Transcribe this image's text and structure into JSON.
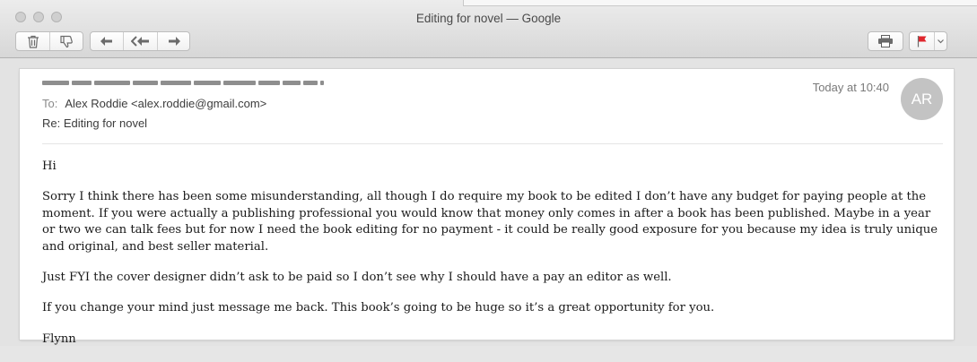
{
  "window": {
    "title": "Editing for novel — Google"
  },
  "toolbar": {
    "buttons": [
      {
        "name": "trash",
        "icon": "trash-icon"
      },
      {
        "name": "junk",
        "icon": "thumbs-down-icon"
      },
      {
        "name": "reply",
        "icon": "reply-icon"
      },
      {
        "name": "reply-all",
        "icon": "reply-all-icon"
      },
      {
        "name": "forward",
        "icon": "forward-icon"
      },
      {
        "name": "print",
        "icon": "printer-icon"
      },
      {
        "name": "flag",
        "icon": "flag-icon",
        "color": "#e0262d"
      }
    ]
  },
  "message": {
    "to_label": "To:",
    "to_value": "Alex Roddie <alex.roddie@gmail.com>",
    "subject": "Re: Editing for novel",
    "time": "Today at 10:40",
    "avatar_initials": "AR",
    "body": [
      "Hi",
      "Sorry I think there has been some misunderstanding, all though I do require my book to be edited I don’t have any budget for paying people at the moment. If you were actually a publishing professional you would know that money only comes in after a book has been published. Maybe in a year or two we can talk fees but for now I need the book editing for no payment - it could be really good exposure for you because my idea is truly unique and original, and best seller material.",
      "Just FYI the cover designer didn’t ask to be paid so I don’t see why I should have a pay an editor as well.",
      "If you change your mind just message me back. This book’s going to be huge so it’s a great opportunity for you.",
      "Flynn"
    ]
  }
}
